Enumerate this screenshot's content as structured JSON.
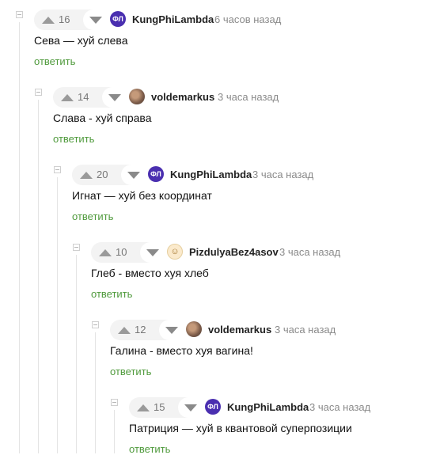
{
  "accent_color": "#4f9a3c",
  "comments": [
    {
      "rating": "16",
      "avatar": "ФЛ",
      "author": "KungPhiLambda",
      "time": "6 часов назад",
      "text": "Сева — хуй слева",
      "reply": "ответить"
    },
    {
      "rating": "14",
      "avatar": "",
      "author": "voldemarkus",
      "time": "3 часа назад",
      "text": "Слава - хуй справа",
      "reply": "ответить"
    },
    {
      "rating": "20",
      "avatar": "ФЛ",
      "author": "KungPhiLambda",
      "time": "3 часа назад",
      "text": "Игнат — хуй без координат",
      "reply": "ответить"
    },
    {
      "rating": "10",
      "avatar": "",
      "author": "PizdulyaBez4asov",
      "time": "3 часа назад",
      "text": "Глеб - вместо хуя хлеб",
      "reply": "ответить"
    },
    {
      "rating": "12",
      "avatar": "",
      "author": "voldemarkus",
      "time": "3 часа назад",
      "text": "Галина - вместо хуя вагина!",
      "reply": "ответить"
    },
    {
      "rating": "15",
      "avatar": "ФЛ",
      "author": "KungPhiLambda",
      "time": "3 часа назад",
      "text": "Патриция — хуй в квантовой суперпозиции",
      "reply": "ответить"
    }
  ]
}
